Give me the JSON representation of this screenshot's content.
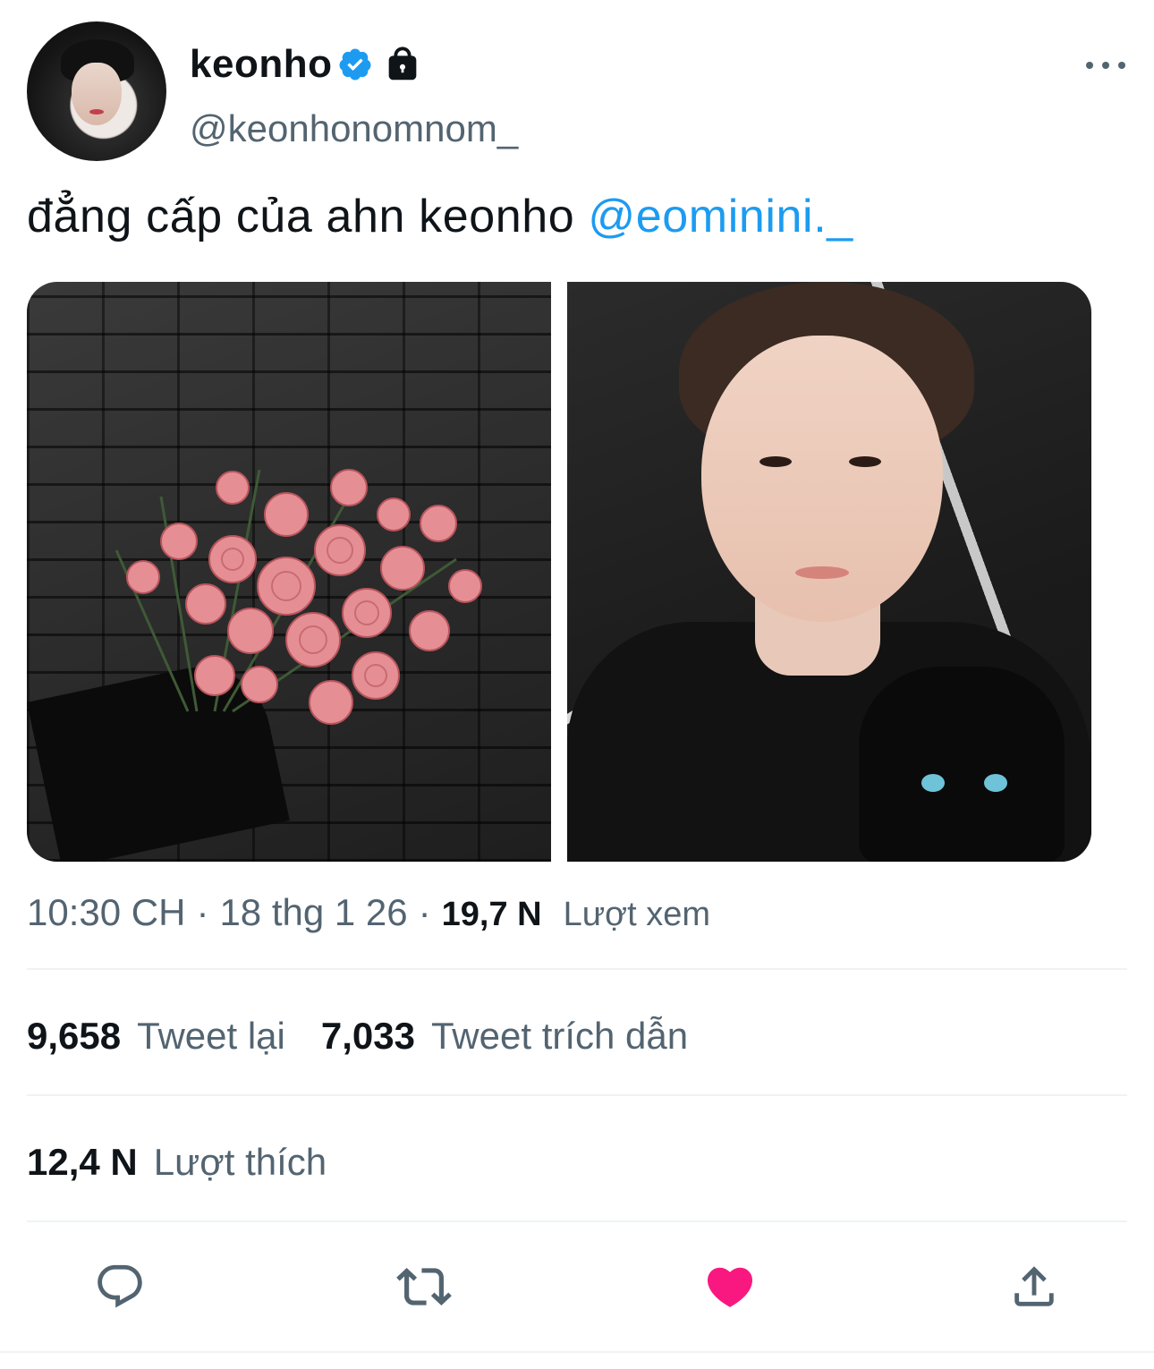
{
  "author": {
    "display_name": "keonho",
    "handle": "@keonhonomnom_",
    "verified": true,
    "protected": true,
    "icons": [
      "verified-badge-icon",
      "lock-icon",
      "more-icon"
    ]
  },
  "tweet": {
    "text": "đẳng cấp của ahn keonho ",
    "mention": "@eominini._",
    "media": [
      "photo-roses-bouquet",
      "photo-selfie"
    ]
  },
  "meta": {
    "time": "10:30 CH",
    "separator": "·",
    "date": "18 thg 1 26",
    "views_count": "19,7 N",
    "views_label": "Lượt xem"
  },
  "stats": {
    "retweets_count": "9,658",
    "retweets_label": "Tweet lại",
    "quotes_count": "7,033",
    "quotes_label": "Tweet trích dẫn",
    "likes_count": "12,4 N",
    "likes_label": "Lượt thích"
  },
  "actions": {
    "icons": [
      "reply-icon",
      "retweet-icon",
      "like-icon",
      "share-icon"
    ],
    "liked": true
  },
  "colors": {
    "accent": "#1d9bf0",
    "like": "#f91880",
    "secondary_text": "#536471",
    "primary_text": "#0f1419"
  }
}
